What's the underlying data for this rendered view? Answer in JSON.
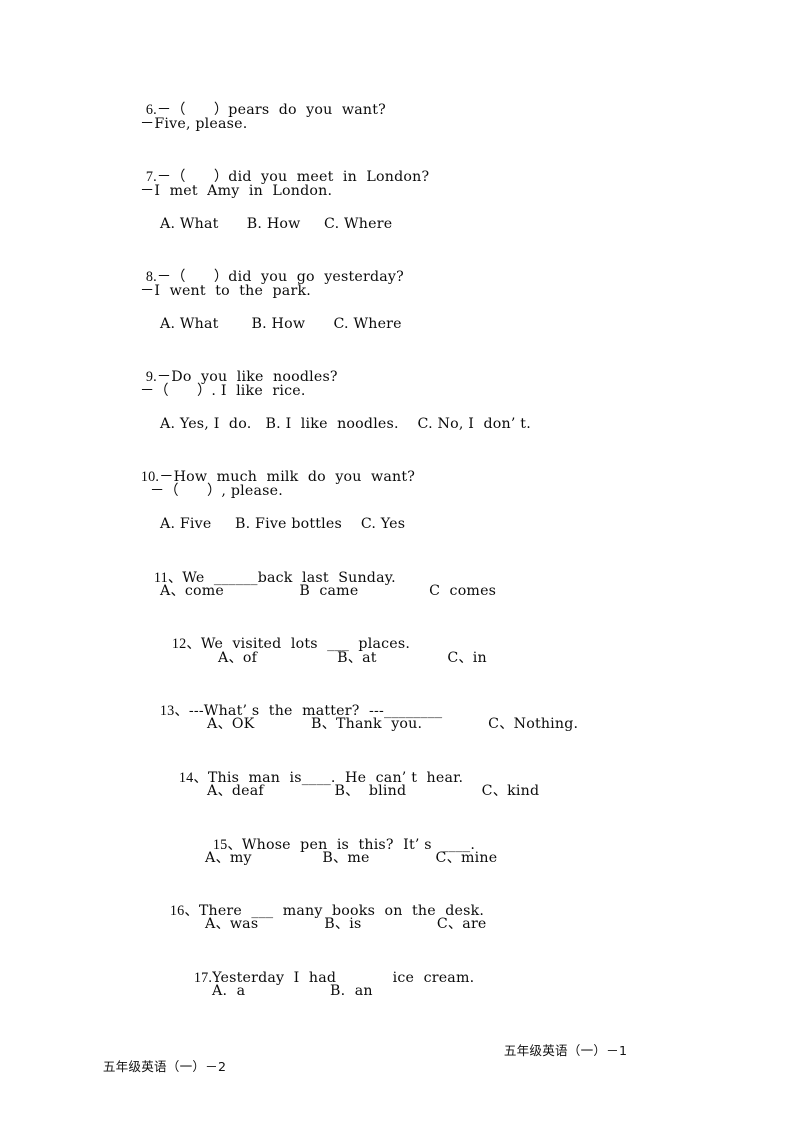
{
  "document": {
    "type": "exam-paper",
    "subject_footer_left": "五年级英语（一）－2",
    "subject_footer_right": "五年级英语（一）－1",
    "text_color": "#0b0b0b",
    "background": "#ffffff"
  },
  "questions": [
    {
      "id": "q6",
      "number": "6.",
      "prompt": "－（      ）pears  do  you  want?",
      "reply": "－Five, please.",
      "options": null
    },
    {
      "id": "q7",
      "number": "7.",
      "prompt": "－（      ）did  you  meet  in  London?",
      "reply": "－I  met  Amy  in  London.",
      "options": "A. What      B. How     C. Where"
    },
    {
      "id": "q8",
      "number": "8.",
      "prompt": "－（      ）did  you  go  yesterday?",
      "reply": "－I  went  to  the  park.",
      "options": "A. What       B. How      C. Where"
    },
    {
      "id": "q9",
      "number": "9.",
      "prompt": "－Do  you  like  noodles?",
      "reply": "－（      ）. I  like  rice.",
      "options": "A. Yes, I  do.   B. I  like  noodles.    C. No, I  don’ t."
    },
    {
      "id": "q10",
      "number": "10.",
      "prompt": "－How  much  milk  do  you  want?",
      "reply": "－（      ）, please.",
      "options": "A. Five     B. Five bottles    C. Yes"
    },
    {
      "id": "q11",
      "number": "11、",
      "prompt": "We  ______back  last  Sunday.",
      "reply": null,
      "options": "A、come                B  came               C  comes"
    },
    {
      "id": "q12",
      "number": "12、",
      "prompt": "We  visited  lots  ___  places.",
      "reply": null,
      "options": "A、of                 B、at               C、in"
    },
    {
      "id": "q13",
      "number": "13、",
      "prompt": "---What’ s  the  matter?  ---________",
      "reply": null,
      "options": "A、OK            B、Thank  you.              C、Nothing."
    },
    {
      "id": "q14",
      "number": "14、",
      "prompt": "This  man  is____.  He  can’ t  hear.",
      "reply": null,
      "options": "A、deaf               B、  blind                C、kind"
    },
    {
      "id": "q15",
      "number": "15、",
      "prompt": "Whose  pen  is  this?  It’ s  ____.",
      "reply": null,
      "options": "A、my               B、me              C、mine"
    },
    {
      "id": "q16",
      "number": "16、",
      "prompt": "There  ___  many  books  on  the  desk.",
      "reply": null,
      "options": "A、was              B、is                C、are"
    },
    {
      "id": "q17",
      "number": "17.",
      "prompt": "Yesterday  I  had            ice  cream.",
      "reply": null,
      "options": "A.  a                  B.  an"
    }
  ]
}
